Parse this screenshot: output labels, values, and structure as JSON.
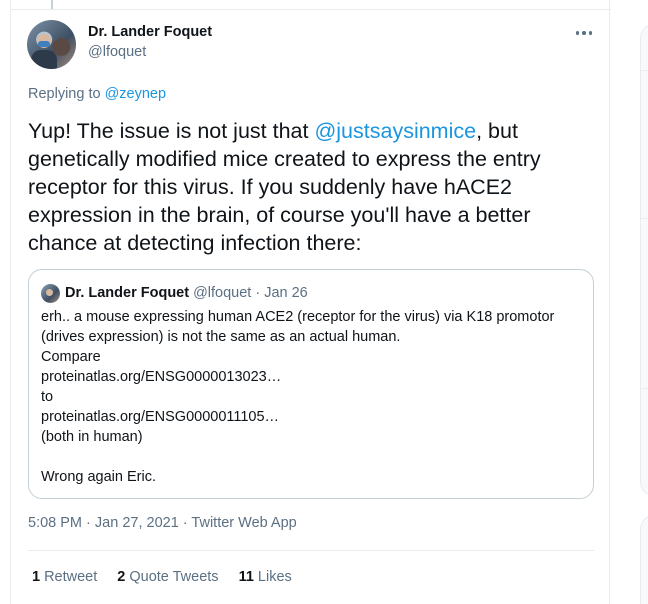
{
  "tweet": {
    "author_name": "Dr. Lander Foquet",
    "author_handle": "@lfoquet",
    "replying_label": "Replying to",
    "replying_to": "@zeynep",
    "text_part1": "Yup! The issue is not just that ",
    "text_mention": "@justsaysinmice",
    "text_part2": ", but genetically modified mice created to express the entry receptor for this virus. If you suddenly have hACE2 expression in the brain, of course you'll have a better chance at detecting infection there:",
    "more_icon": "more-horizontal-icon"
  },
  "quote": {
    "author_name": "Dr. Lander Foquet",
    "author_handle": "@lfoquet",
    "separator": "·",
    "date": "Jan 26",
    "lines": [
      "erh.. a mouse expressing human ACE2 (receptor for the virus) via K18 promotor (drives expression) is not the same as an actual human.",
      "Compare",
      "proteinatlas.org/ENSG0000013023…",
      "to",
      "proteinatlas.org/ENSG0000011105…",
      "(both in human)",
      "",
      "Wrong again Eric."
    ]
  },
  "meta": {
    "time": "5:08 PM",
    "sep1": "·",
    "date": "Jan 27, 2021",
    "sep2": "·",
    "source": "Twitter Web App"
  },
  "stats": {
    "retweets_count": "1",
    "retweets_label": "Retweet",
    "quotes_count": "2",
    "quotes_label": "Quote Tweets",
    "likes_count": "11",
    "likes_label": "Likes"
  },
  "colors": {
    "link": "#1b95e0",
    "secondary_text": "#5b7083",
    "border": "#e6ecf0"
  }
}
